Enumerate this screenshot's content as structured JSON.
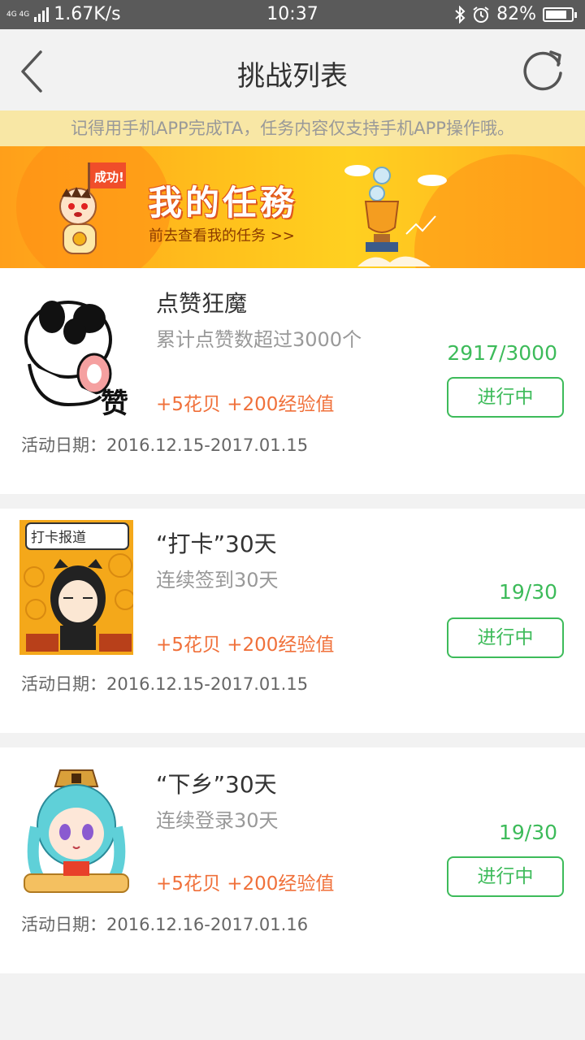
{
  "statusbar": {
    "network": "4G 4G",
    "speed": "1.67K/s",
    "time": "10:37",
    "battery": "82%",
    "battery_level": 0.82
  },
  "header": {
    "title": "挑战列表"
  },
  "notice": "记得用手机APP完成TA，任务内容仅支持手机APP操作哦。",
  "banner": {
    "title": "我的任務",
    "link": "前去查看我的任务 >>",
    "flag_text": "成功!"
  },
  "challenges": [
    {
      "name": "点赞狂魔",
      "desc": "累计点赞数超过3000个",
      "reward": "+5花贝 +200经验值",
      "progress": "2917/3000",
      "status": "进行中",
      "date": "活动日期：2016.12.15-2017.01.15",
      "image_text": "赞"
    },
    {
      "name": "“打卡”30天",
      "desc": "连续签到30天",
      "reward": "+5花贝 +200经验值",
      "progress": "19/30",
      "status": "进行中",
      "date": "活动日期：2016.12.15-2017.01.15",
      "image_text": "打卡报道"
    },
    {
      "name": "“下乡”30天",
      "desc": "连续登录30天",
      "reward": "+5花贝 +200经验值",
      "progress": "19/30",
      "status": "进行中",
      "date": "活动日期：2016.12.16-2017.01.16"
    }
  ],
  "colors": {
    "accent_green": "#3dbb5a",
    "reward_orange": "#f0703a",
    "notice_bg": "#f8e7a5"
  }
}
